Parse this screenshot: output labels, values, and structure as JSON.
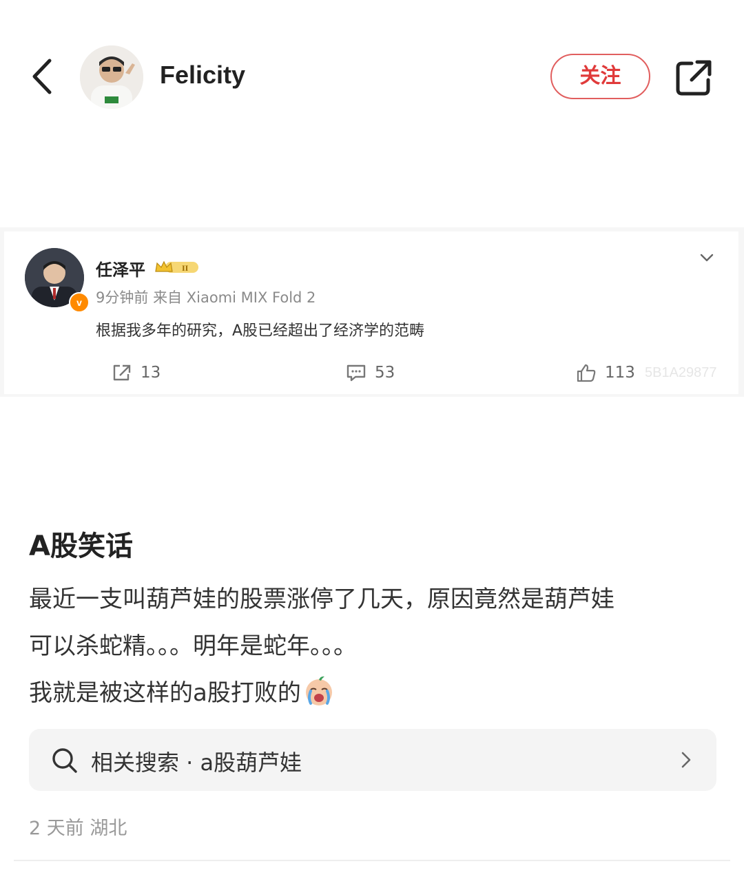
{
  "header": {
    "username": "Felicity",
    "follow_label": "关注"
  },
  "quoted_post": {
    "author": "任泽平",
    "rank_badge": "II",
    "verified_badge": "v",
    "time": "9分钟前",
    "source": "来自 Xiaomi MIX Fold 2",
    "text": "根据我多年的研究，A股已经超出了经济学的范畴",
    "repost_count": "13",
    "comment_count": "53",
    "like_count": "113",
    "watermark": "5B1A29877"
  },
  "post": {
    "title": "A股笑话",
    "lines": [
      "最近一支叫葫芦娃的股票涨停了几天，原因竟然是葫芦娃",
      "可以杀蛇精。。。明年是蛇年。。。",
      "我就是被这样的a股打败的"
    ],
    "emoji": "crying-face"
  },
  "related_search": {
    "label": "相关搜索 · a股葫芦娃"
  },
  "meta": {
    "time_location": "2 天前  湖北"
  },
  "colors": {
    "follow_red": "#e03a3a",
    "text_main": "#222222",
    "text_muted": "#999999"
  }
}
